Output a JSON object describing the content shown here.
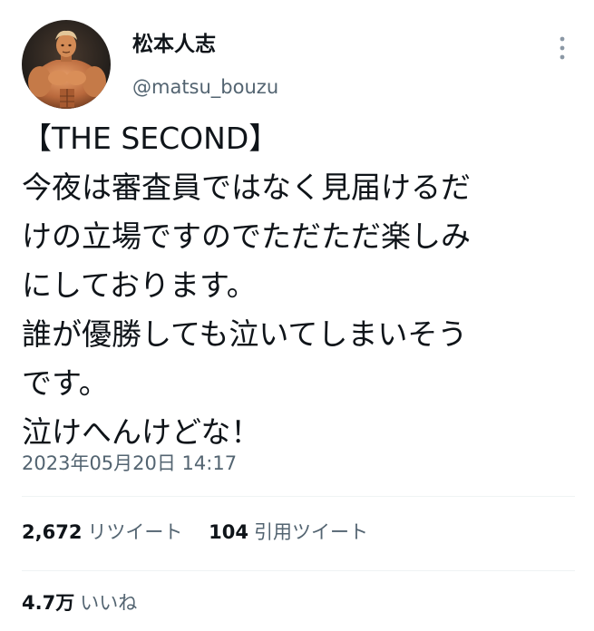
{
  "author": {
    "display_name": "松本人志",
    "handle": "@matsu_bouzu",
    "avatar_icon": "bodybuilder-figure-avatar"
  },
  "more_icon": "more-vertical-icon",
  "tweet": {
    "lines": [
      "【THE SECOND】",
      "今夜は審査員ではなく見届けるだ",
      "けの立場ですのでただただ楽しみ",
      "にしております。",
      "誰が優勝しても泣いてしまいそう",
      "です。",
      "泣けへんけどな！"
    ],
    "timestamp": "2023年05月20日 14:17"
  },
  "stats": {
    "retweets": {
      "count": "2,672",
      "label": "リツイート"
    },
    "quote_tweets": {
      "count": "104",
      "label": "引用ツイート"
    },
    "likes": {
      "count": "4.7万",
      "label": "いいね"
    }
  },
  "colors": {
    "text_primary": "#0f1419",
    "text_secondary": "#536471",
    "divider": "#eff3f4"
  }
}
